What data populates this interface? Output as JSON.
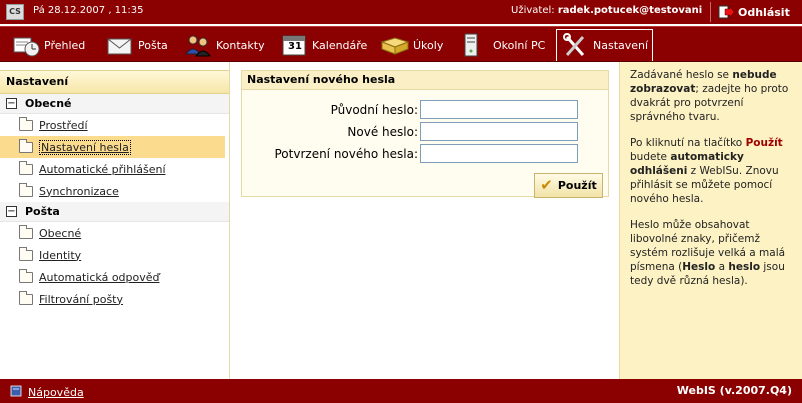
{
  "topbar": {
    "logo": "CS",
    "date": "Pá 28.12.2007 , 11:35",
    "user_label": "Uživatel:",
    "username": "radek.potucek@testovani",
    "logout": "Odhlásit"
  },
  "nav": {
    "items": [
      {
        "label": "Přehled",
        "icon": "overview-icon"
      },
      {
        "label": "Pošta",
        "icon": "mail-icon"
      },
      {
        "label": "Kontakty",
        "icon": "contacts-icon"
      },
      {
        "label": "Kalendáře",
        "icon": "calendar-icon"
      },
      {
        "label": "Úkoly",
        "icon": "tasks-icon"
      },
      {
        "label": "Okolní PC",
        "icon": "network-pc-icon"
      },
      {
        "label": "Nastavení",
        "icon": "settings-tools-icon"
      }
    ],
    "calendar_day": "31"
  },
  "sidebar": {
    "title": "Nastavení",
    "groups": [
      {
        "label": "Obecné",
        "toggle": "−",
        "items": [
          "Prostředí",
          "Nastavení hesla",
          "Automatické přihlášení",
          "Synchronizace"
        ]
      },
      {
        "label": "Pošta",
        "toggle": "−",
        "items": [
          "Obecné",
          "Identity",
          "Automatická odpověď",
          "Filtrování pošty"
        ]
      }
    ]
  },
  "form": {
    "title": "Nastavení nového hesla",
    "fields": [
      {
        "label": "Původní heslo:",
        "value": ""
      },
      {
        "label": "Nové heslo:",
        "value": ""
      },
      {
        "label": "Potvrzení nového hesla:",
        "value": ""
      }
    ],
    "submit": "Použít"
  },
  "help": {
    "p1_a": "Zadávané heslo se ",
    "p1_b": "nebude zobrazovat",
    "p1_c": "; zadejte ho proto dvakrát pro potvrzení správného tvaru.",
    "p2_a": "Po kliknutí na tlačítko ",
    "p2_b": "Použít",
    "p2_c": " budete ",
    "p2_d": "automaticky odhlášeni",
    "p2_e": " z WebISu. Znovu přihlásit se můžete pomocí nového hesla.",
    "p3_a": "Heslo může obsahovat libovolné znaky, přičemž systém rozlišuje velká a malá písmena (",
    "p3_b": "Heslo",
    "p3_c": " a ",
    "p3_d": "heslo",
    "p3_e": " jsou tedy dvě různá hesla)."
  },
  "footer": {
    "help": "Nápověda",
    "version": "WebIS (v.2007.Q4)"
  }
}
